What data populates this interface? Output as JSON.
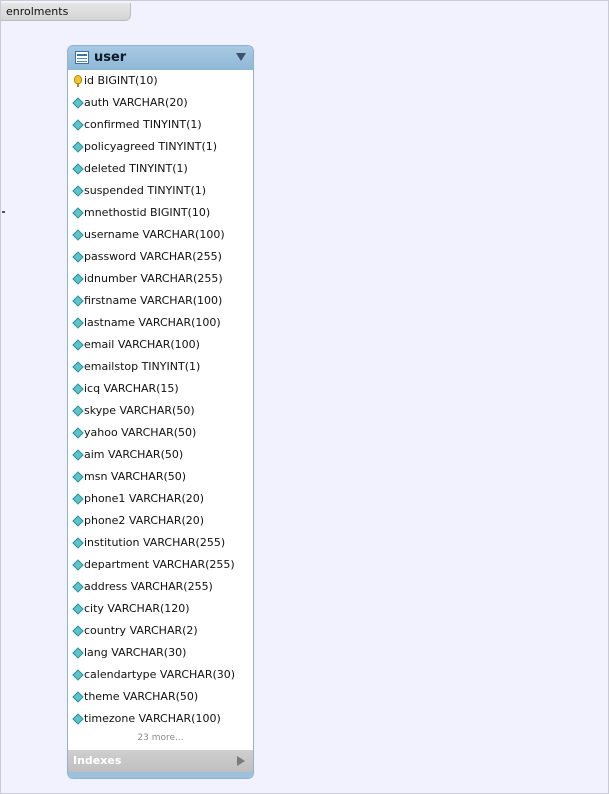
{
  "layer": {
    "name": "enrolments"
  },
  "table": {
    "name": "user",
    "columns": [
      {
        "label": "id BIGINT(10)",
        "icon": "primary-key-icon"
      },
      {
        "label": "auth VARCHAR(20)",
        "icon": "column-icon"
      },
      {
        "label": "confirmed TINYINT(1)",
        "icon": "column-icon"
      },
      {
        "label": "policyagreed TINYINT(1)",
        "icon": "column-icon"
      },
      {
        "label": "deleted TINYINT(1)",
        "icon": "column-icon"
      },
      {
        "label": "suspended TINYINT(1)",
        "icon": "column-icon"
      },
      {
        "label": "mnethostid BIGINT(10)",
        "icon": "column-icon"
      },
      {
        "label": "username VARCHAR(100)",
        "icon": "column-icon"
      },
      {
        "label": "password VARCHAR(255)",
        "icon": "column-icon"
      },
      {
        "label": "idnumber VARCHAR(255)",
        "icon": "column-icon"
      },
      {
        "label": "firstname VARCHAR(100)",
        "icon": "column-icon"
      },
      {
        "label": "lastname VARCHAR(100)",
        "icon": "column-icon"
      },
      {
        "label": "email VARCHAR(100)",
        "icon": "column-icon"
      },
      {
        "label": "emailstop TINYINT(1)",
        "icon": "column-icon"
      },
      {
        "label": "icq VARCHAR(15)",
        "icon": "column-icon"
      },
      {
        "label": "skype VARCHAR(50)",
        "icon": "column-icon"
      },
      {
        "label": "yahoo VARCHAR(50)",
        "icon": "column-icon"
      },
      {
        "label": "aim VARCHAR(50)",
        "icon": "column-icon"
      },
      {
        "label": "msn VARCHAR(50)",
        "icon": "column-icon"
      },
      {
        "label": "phone1 VARCHAR(20)",
        "icon": "column-icon"
      },
      {
        "label": "phone2 VARCHAR(20)",
        "icon": "column-icon"
      },
      {
        "label": "institution VARCHAR(255)",
        "icon": "column-icon"
      },
      {
        "label": "department VARCHAR(255)",
        "icon": "column-icon"
      },
      {
        "label": "address VARCHAR(255)",
        "icon": "column-icon"
      },
      {
        "label": "city VARCHAR(120)",
        "icon": "column-icon"
      },
      {
        "label": "country VARCHAR(2)",
        "icon": "column-icon"
      },
      {
        "label": "lang VARCHAR(30)",
        "icon": "column-icon"
      },
      {
        "label": "calendartype VARCHAR(30)",
        "icon": "column-icon"
      },
      {
        "label": "theme VARCHAR(50)",
        "icon": "column-icon"
      },
      {
        "label": "timezone VARCHAR(100)",
        "icon": "column-icon"
      }
    ],
    "more_label": "23 more...",
    "indexes_label": "Indexes"
  },
  "colors": {
    "canvas": "#f1f2fd",
    "header": "#9dc0dc",
    "column_icon": "#5cc4cc",
    "key_icon": "#f4c430"
  }
}
